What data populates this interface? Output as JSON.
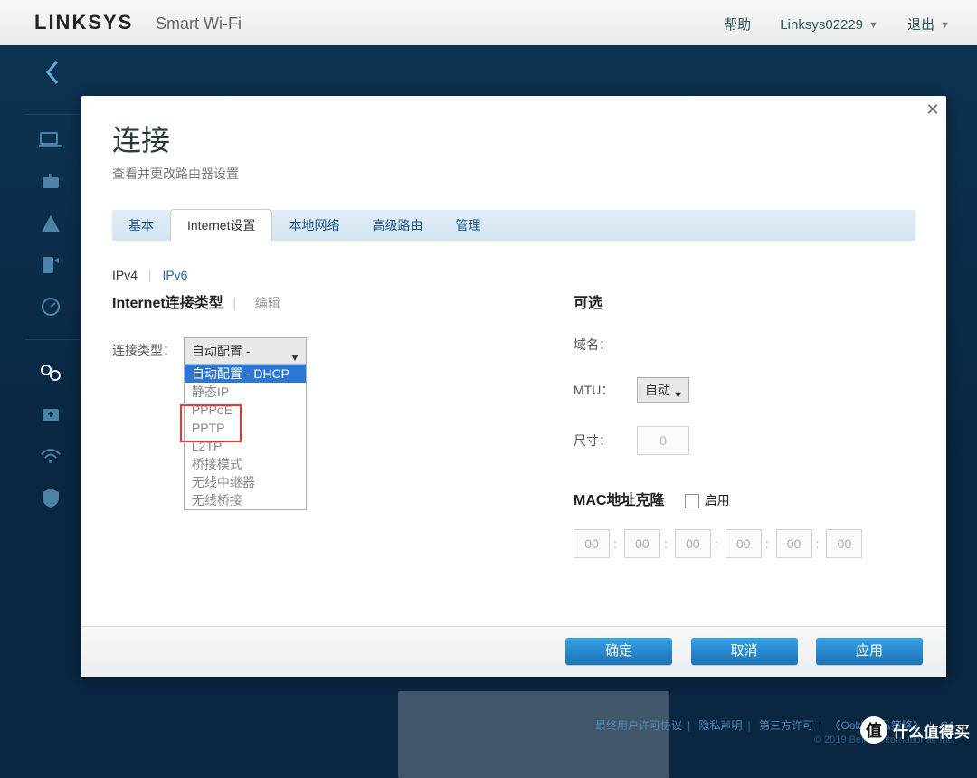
{
  "header": {
    "brand": "LINKSYS",
    "brand_sub": "Smart Wi-Fi",
    "help": "帮助",
    "account": "Linksys02229",
    "logout": "退出"
  },
  "modal": {
    "title": "连接",
    "subtitle": "查看并更改路由器设置",
    "tabs": [
      "基本",
      "Internet设置",
      "本地网络",
      "高级路由",
      "管理"
    ],
    "proto_ipv4": "IPv4",
    "proto_ipv6": "IPv6",
    "left_heading": "Internet连接类型",
    "edit": "编辑",
    "conn_label": "连接类型：",
    "conn_value": "自动配置 - DHCP",
    "conn_options": [
      "自动配置 - DHCP",
      "静态IP",
      "PPPoE",
      "PPTP",
      "L2TP",
      "桥接模式",
      "无线中继器",
      "无线桥接"
    ],
    "right_heading": "可选",
    "domain_label": "域名：",
    "mtu_label": "MTU：",
    "mtu_value": "自动",
    "size_label": "尺寸：",
    "size_value": "0",
    "mac_heading": "MAC地址克隆",
    "enable_label": "启用",
    "mac": [
      "00",
      "00",
      "00",
      "00",
      "00",
      "00"
    ],
    "btn_ok": "确定",
    "btn_cancel": "取消",
    "btn_apply": "应用"
  },
  "footer": {
    "links": [
      "最终用户许可协议",
      "隐私声明",
      "第三方许可",
      "《Ookla隐私策略》",
      "CA"
    ],
    "copyright": "© 2019 Belkin International, Inc."
  },
  "watermark": "什么值得买"
}
